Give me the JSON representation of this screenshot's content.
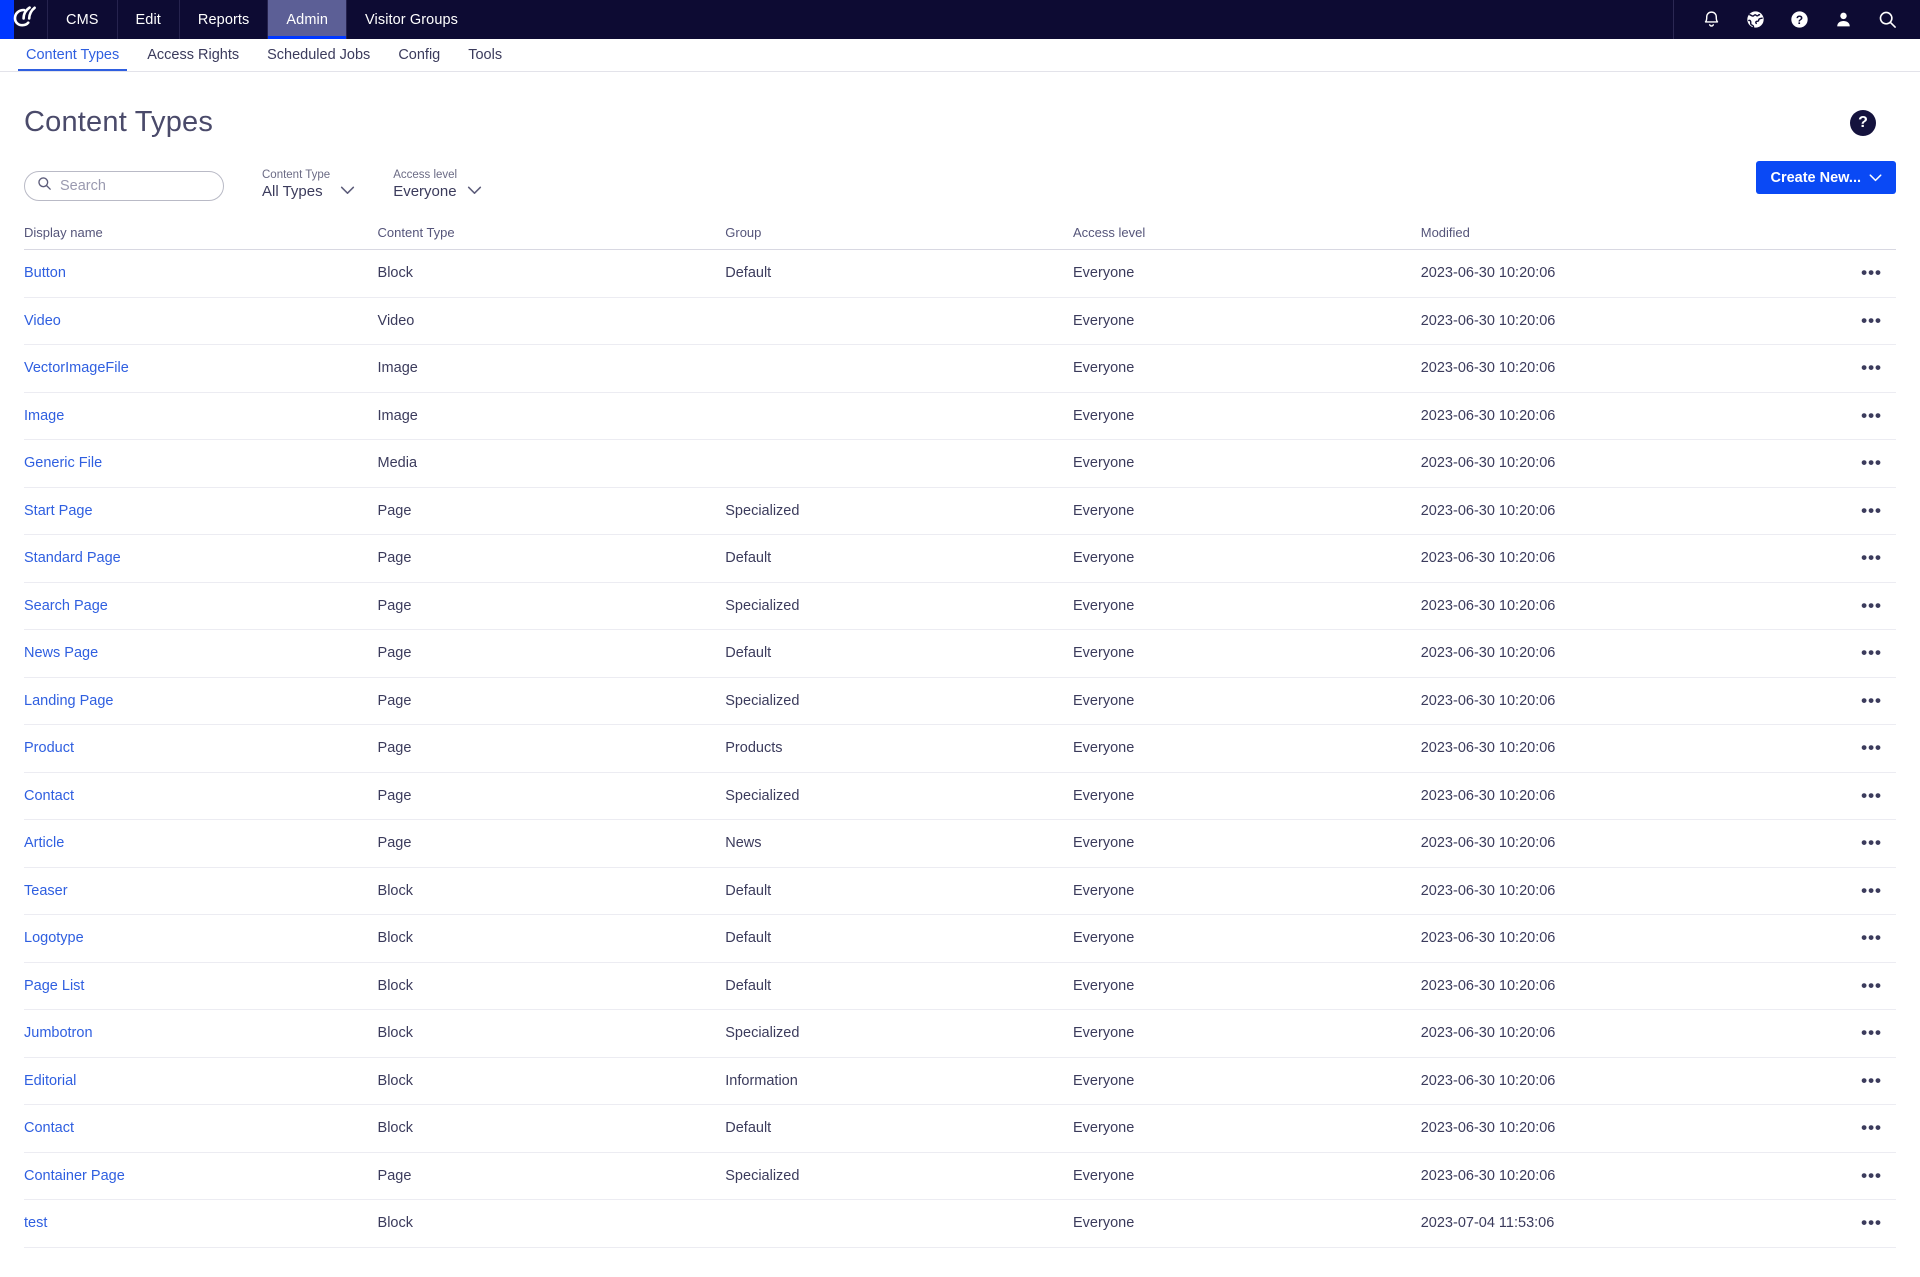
{
  "app": {
    "logo_icon": "optimizely-logo-icon",
    "accent_blue": "#0037ff",
    "topbar_bg": "#0d0b33",
    "link_blue": "#2f5fe0",
    "button_blue": "#0a49f5"
  },
  "topnav": {
    "items": [
      {
        "label": "CMS",
        "active": false
      },
      {
        "label": "Edit",
        "active": false
      },
      {
        "label": "Reports",
        "active": false
      },
      {
        "label": "Admin",
        "active": true
      },
      {
        "label": "Visitor Groups",
        "active": false
      }
    ],
    "icons": [
      {
        "name": "bell-icon",
        "title": "Notifications"
      },
      {
        "name": "globe-icon",
        "title": "Global"
      },
      {
        "name": "help-icon",
        "title": "Help"
      },
      {
        "name": "user-icon",
        "title": "Profile"
      },
      {
        "name": "search-icon",
        "title": "Search"
      }
    ]
  },
  "subnav": {
    "items": [
      {
        "label": "Content Types",
        "active": true
      },
      {
        "label": "Access Rights",
        "active": false
      },
      {
        "label": "Scheduled Jobs",
        "active": false
      },
      {
        "label": "Config",
        "active": false
      },
      {
        "label": "Tools",
        "active": false
      }
    ]
  },
  "page": {
    "title": "Content Types",
    "help_badge": "?"
  },
  "toolbar": {
    "search_placeholder": "Search",
    "search_value": "",
    "filters": [
      {
        "label": "Content Type",
        "value": "All Types"
      },
      {
        "label": "Access level",
        "value": "Everyone"
      }
    ],
    "create_label": "Create New..."
  },
  "table": {
    "columns": [
      "Display name",
      "Content Type",
      "Group",
      "Access level",
      "Modified"
    ],
    "row_action_glyph": "•••",
    "rows": [
      {
        "name": "Button",
        "type": "Block",
        "group": "Default",
        "access": "Everyone",
        "modified": "2023-06-30 10:20:06"
      },
      {
        "name": "Video",
        "type": "Video",
        "group": "",
        "access": "Everyone",
        "modified": "2023-06-30 10:20:06"
      },
      {
        "name": "VectorImageFile",
        "type": "Image",
        "group": "",
        "access": "Everyone",
        "modified": "2023-06-30 10:20:06"
      },
      {
        "name": "Image",
        "type": "Image",
        "group": "",
        "access": "Everyone",
        "modified": "2023-06-30 10:20:06"
      },
      {
        "name": "Generic File",
        "type": "Media",
        "group": "",
        "access": "Everyone",
        "modified": "2023-06-30 10:20:06"
      },
      {
        "name": "Start Page",
        "type": "Page",
        "group": "Specialized",
        "access": "Everyone",
        "modified": "2023-06-30 10:20:06"
      },
      {
        "name": "Standard Page",
        "type": "Page",
        "group": "Default",
        "access": "Everyone",
        "modified": "2023-06-30 10:20:06"
      },
      {
        "name": "Search Page",
        "type": "Page",
        "group": "Specialized",
        "access": "Everyone",
        "modified": "2023-06-30 10:20:06"
      },
      {
        "name": "News Page",
        "type": "Page",
        "group": "Default",
        "access": "Everyone",
        "modified": "2023-06-30 10:20:06"
      },
      {
        "name": "Landing Page",
        "type": "Page",
        "group": "Specialized",
        "access": "Everyone",
        "modified": "2023-06-30 10:20:06"
      },
      {
        "name": "Product",
        "type": "Page",
        "group": "Products",
        "access": "Everyone",
        "modified": "2023-06-30 10:20:06"
      },
      {
        "name": "Contact",
        "type": "Page",
        "group": "Specialized",
        "access": "Everyone",
        "modified": "2023-06-30 10:20:06"
      },
      {
        "name": "Article",
        "type": "Page",
        "group": "News",
        "access": "Everyone",
        "modified": "2023-06-30 10:20:06"
      },
      {
        "name": "Teaser",
        "type": "Block",
        "group": "Default",
        "access": "Everyone",
        "modified": "2023-06-30 10:20:06"
      },
      {
        "name": "Logotype",
        "type": "Block",
        "group": "Default",
        "access": "Everyone",
        "modified": "2023-06-30 10:20:06"
      },
      {
        "name": "Page List",
        "type": "Block",
        "group": "Default",
        "access": "Everyone",
        "modified": "2023-06-30 10:20:06"
      },
      {
        "name": "Jumbotron",
        "type": "Block",
        "group": "Specialized",
        "access": "Everyone",
        "modified": "2023-06-30 10:20:06"
      },
      {
        "name": "Editorial",
        "type": "Block",
        "group": "Information",
        "access": "Everyone",
        "modified": "2023-06-30 10:20:06"
      },
      {
        "name": "Contact",
        "type": "Block",
        "group": "Default",
        "access": "Everyone",
        "modified": "2023-06-30 10:20:06"
      },
      {
        "name": "Container Page",
        "type": "Page",
        "group": "Specialized",
        "access": "Everyone",
        "modified": "2023-06-30 10:20:06"
      },
      {
        "name": "test",
        "type": "Block",
        "group": "",
        "access": "Everyone",
        "modified": "2023-07-04 11:53:06"
      }
    ]
  }
}
